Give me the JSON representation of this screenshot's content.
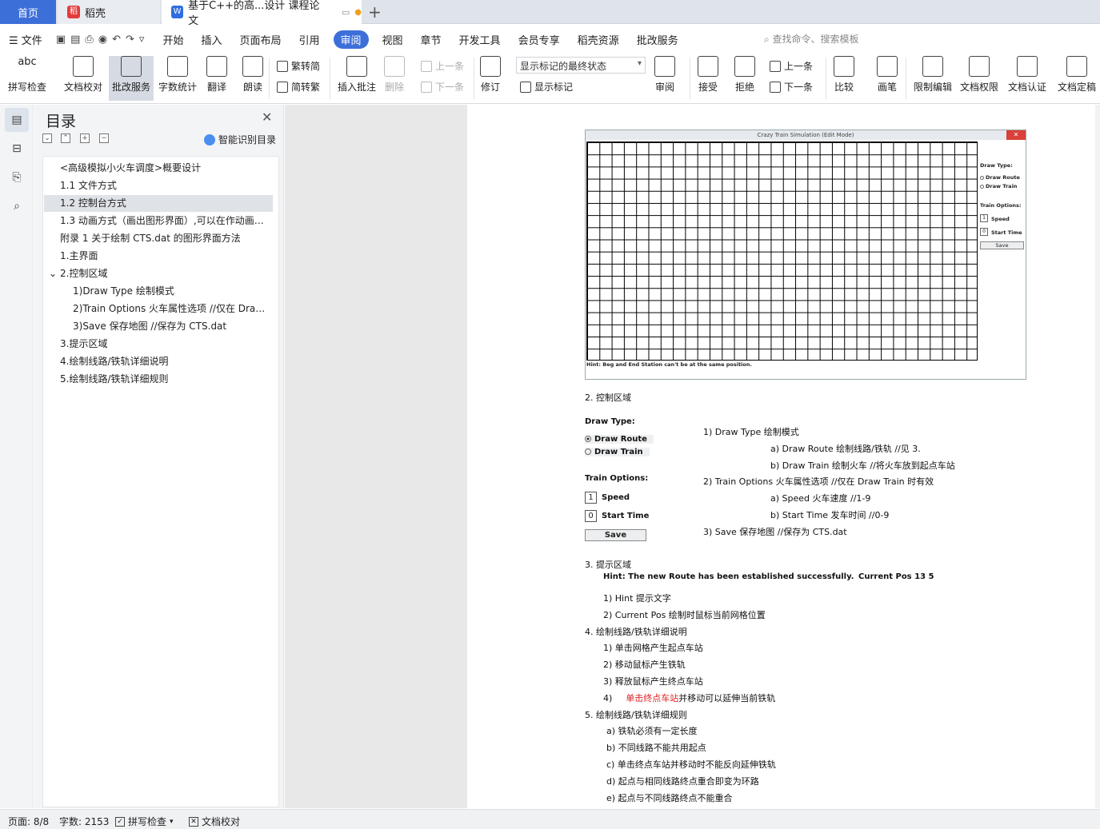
{
  "tabs": {
    "home": "首页",
    "daoke": "稻壳",
    "doc": "基于C++的高...设计 课程论文"
  },
  "menu": {
    "file": "文件",
    "items": [
      "开始",
      "插入",
      "页面布局",
      "引用",
      "审阅",
      "视图",
      "章节",
      "开发工具",
      "会员专享",
      "稻壳资源",
      "批改服务"
    ],
    "active": "审阅",
    "search_placeholder": "查找命令、搜索模板"
  },
  "ribbon": {
    "spell": "拼写检查",
    "proof": "文档校对",
    "review_service": "批改服务",
    "wordcount": "字数统计",
    "translate": "翻译",
    "read": "朗读",
    "trad": "繁转简",
    "simp": "简转繁",
    "insert_comment": "插入批注",
    "delete": "删除",
    "prev": "上一条",
    "next": "下一条",
    "revise": "修订",
    "markup_dropdown": "显示标记的最终状态",
    "show_markup": "显示标记",
    "reviewpane": "审阅",
    "accept": "接受",
    "reject": "拒绝",
    "prev2": "上一条",
    "next2": "下一条",
    "compare": "比较",
    "pen": "画笔",
    "restrict": "限制编辑",
    "perm": "文档权限",
    "cert": "文档认证",
    "final": "文档定稿"
  },
  "toc": {
    "title": "目录",
    "smart": "智能识别目录",
    "items": [
      "<高级模拟小火车调度>概要设计",
      "1.1  文件方式",
      "1.2  控制台方式",
      "1.3  动画方式（画出图形界面）,可以在作动画时...",
      "附录 1  关于绘制 CTS.dat 的图形界面方法",
      "1.主界面",
      "2.控制区域",
      "1)Draw Type 绘制模式",
      "2)Train Options  火车属性选项   //仅在 Draw Train...",
      "3)Save  保存地图   //保存为 CTS.dat",
      "3.提示区域",
      "4.绘制线路/铁轨详细说明",
      "5.绘制线路/铁轨详细规则"
    ]
  },
  "win": {
    "title": "Crazy Train Simulation (Edit Mode)",
    "draw_type": "Draw Type:",
    "route": "Draw Route",
    "train": "Draw Train",
    "train_options": "Train Options:",
    "speed": "Speed",
    "start": "Start Time",
    "speed_val": "1",
    "start_val": "0",
    "save": "Save",
    "hint": "Hint: Beg and End Station can't be at the same position."
  },
  "doc": {
    "s2": "2.      控制区域",
    "draw_type": "Draw Type:",
    "route": "Draw Route",
    "train": "Draw Train",
    "train_options": "Train Options:",
    "speed": "Speed",
    "speed_val": "1",
    "start": "Start Time",
    "start_val": "0",
    "save": "Save",
    "l1": "1)     Draw Type 绘制模式",
    "l1a": "a)      Draw Route  绘制线路/铁轨    //见 3.",
    "l1b": "b)      Draw Train  绘制火车    //将火车放到起点车站",
    "l2": "2)     Train Options  火车属性选项    //仅在 Draw Train 时有效",
    "l2a": "a)      Speed  火车速度    //1-9",
    "l2b": "b)      Start Time  发车时间    //0-9",
    "l3": "3)     Save  保存地图    //保存为 CTS.dat",
    "s3": "3.      提示区域",
    "hint": "Hint: The new Route has been established successfully.",
    "curpos": "Current Pos   13     5",
    "h1": "1)     Hint  提示文字",
    "h2": "2)     Current Pos  绘制时鼠标当前网格位置",
    "s4": "4.      绘制线路/铁轨详细说明",
    "d1": "1)     单击网格产生起点车站",
    "d2": "2)     移动鼠标产生铁轨",
    "d3": "3)     释放鼠标产生终点车站",
    "d4_red": "单击终点车站",
    "d4_rest": "并移动可以延伸当前铁轨",
    "d4_num": "4)",
    "s5": "5.      绘制线路/铁轨详细规则",
    "r1": "a)      铁轨必须有一定长度",
    "r2": "b)      不同线路不能共用起点",
    "r3": "c)      单击终点车站并移动时不能反向延伸铁轨",
    "r4": "d)      起点与相同线路终点重合即变为环路",
    "r5": "e)      起点与不同线路终点不能重合"
  },
  "status": {
    "page": "页面: 8/8",
    "words": "字数: 2153",
    "spell": "拼写检查",
    "proof": "文档校对"
  }
}
